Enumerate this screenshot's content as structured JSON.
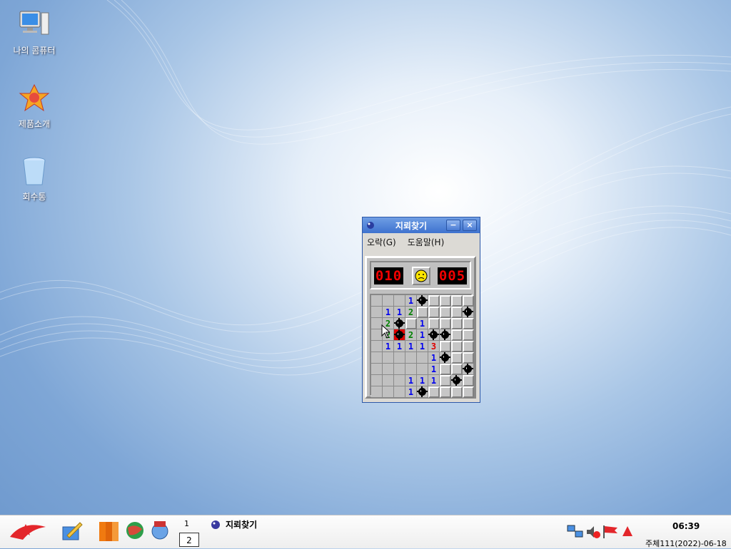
{
  "desktop": {
    "icons": [
      {
        "label": "나의 콤퓨터",
        "icon": "computer-icon"
      },
      {
        "label": "제품소개",
        "icon": "product-intro-icon"
      },
      {
        "label": "회수통",
        "icon": "trash-icon"
      }
    ]
  },
  "window": {
    "title": "지뢰찾기",
    "minimize_label": "−",
    "close_label": "×",
    "menu": [
      {
        "label": "오락(G)"
      },
      {
        "label": "도움말(H)"
      }
    ]
  },
  "game": {
    "mine_counter": "010",
    "timer": "005",
    "face": "sad-face",
    "board": [
      [
        "o",
        "o",
        "o",
        "1",
        "M",
        "c",
        "c",
        "c",
        "c"
      ],
      [
        "o",
        "1",
        "1",
        "2",
        "c",
        "c",
        "c",
        "c",
        "M"
      ],
      [
        "o",
        "2",
        "M",
        "c",
        "1",
        "c",
        "c",
        "c",
        "c"
      ],
      [
        "o",
        "2",
        "X",
        "2",
        "1",
        "M",
        "M",
        "c",
        "c"
      ],
      [
        "o",
        "1",
        "1",
        "1",
        "1",
        "3",
        "c",
        "c",
        "c"
      ],
      [
        "o",
        "o",
        "o",
        "o",
        "o",
        "1",
        "M",
        "c",
        "c"
      ],
      [
        "o",
        "o",
        "o",
        "o",
        "o",
        "1",
        "c",
        "c",
        "M"
      ],
      [
        "o",
        "o",
        "o",
        "1",
        "1",
        "1",
        "c",
        "M",
        "c"
      ],
      [
        "o",
        "o",
        "o",
        "1",
        "M",
        "c",
        "c",
        "c",
        "c"
      ]
    ]
  },
  "taskbar": {
    "workspace_top": "1",
    "workspace_current": "2",
    "task_label": "지뢰찾기",
    "clock": "06:39",
    "date": "주체111(2022)-06-18",
    "launchers": [
      "start-menu-icon",
      "editor-icon",
      "books-icon",
      "globe-icon",
      "media-icon"
    ],
    "tray": [
      "network-icon",
      "volume-muted-icon",
      "flag-icon",
      "alert-icon"
    ]
  },
  "colors": {
    "titlebar": "#3e72cf",
    "led_text": "#f20000",
    "number1": "#0000ee",
    "number2": "#008000",
    "number3": "#e00000"
  }
}
